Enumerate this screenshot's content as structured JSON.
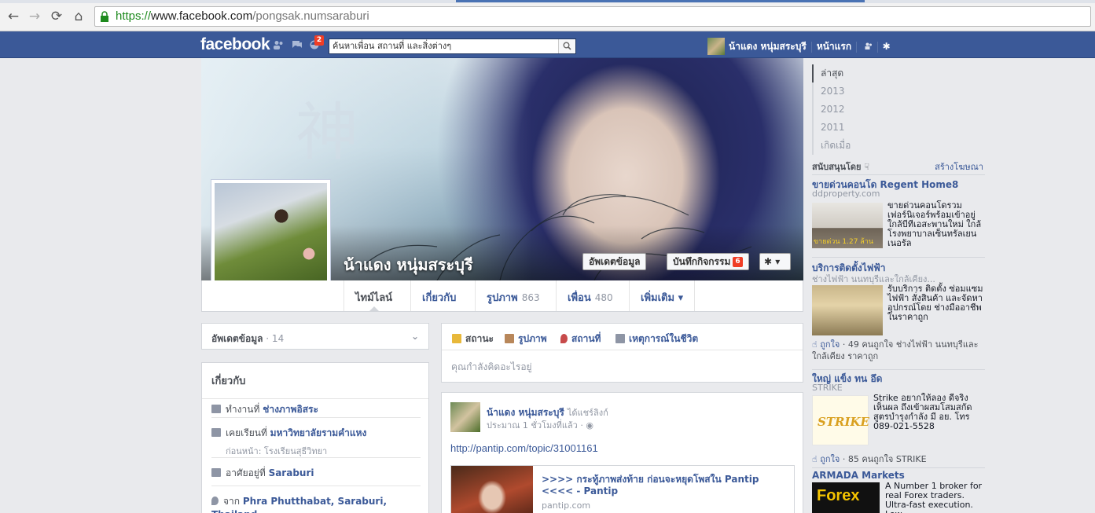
{
  "browser": {
    "url_scheme": "https://",
    "url_host": "www.facebook.com",
    "url_path": "/pongsak.numsaraburi",
    "back": "←",
    "forward": "→",
    "reload": "⟳",
    "home": "⌂"
  },
  "topbar": {
    "logo": "facebook",
    "notification_count": "2",
    "search_placeholder": "ค้นหาเพื่อน สถานที่ และสิ่งต่างๆ",
    "user_name": "น้าแดง หนุ่มสระบุรี",
    "home_link": "หน้าแรก",
    "settings_glyph": "✱"
  },
  "cover": {
    "profile_name": "น้าแดง หนุ่มสระบุรี",
    "update_info_label": "อัพเดตข้อมูล",
    "activity_log_label": "บันทึกกิจกรรม",
    "activity_badge": "6",
    "gear_glyph": "✱ ▾",
    "art_glyph": "神"
  },
  "nav_tabs": [
    {
      "label": "ไทม์ไลน์",
      "count": ""
    },
    {
      "label": "เกี่ยวกับ",
      "count": ""
    },
    {
      "label": "รูปภาพ",
      "count": "863"
    },
    {
      "label": "เพื่อน",
      "count": "480"
    },
    {
      "label": "เพิ่มเติม ▾",
      "count": ""
    }
  ],
  "left": {
    "updates_title": "อัพเดตข้อมูล",
    "updates_count": " · 14",
    "chevron": "⌄",
    "about_title": "เกี่ยวกับ",
    "rows": [
      {
        "prefix": "ทำงานที่ ",
        "value": "ช่างภาพอิสระ",
        "sub": ""
      },
      {
        "prefix": "เคยเรียนที่ ",
        "value": "มหาวิทยาลัยรามคำแหง",
        "sub": "ก่อนหน้า: โรงเรียนสุธีวิทยา"
      },
      {
        "prefix": "อาศัยอยู่ที่ ",
        "value": "Saraburi",
        "sub": ""
      },
      {
        "prefix": "จาก ",
        "value": "Phra Phutthabat, Saraburi, Thailand",
        "sub": ""
      }
    ]
  },
  "composer": {
    "tabs": [
      "สถานะ",
      "รูปภาพ",
      "สถานที่",
      "เหตุการณ์ในชีวิต"
    ],
    "placeholder": "คุณกำลังคิดอะไรอยู่"
  },
  "story": {
    "author": "น้าแดง หนุ่มสระบุรี",
    "action": "ได้แชร์ลิงก์",
    "time": "ประมาณ 1 ชั่วโมงที่แล้ว · ◉",
    "link": "http://pantip.com/topic/31001161",
    "att_title": ">>>> กระทู้ภาพส่งท้าย ก่อนจะหยุดโพสใน Pantip <<<< - Pantip",
    "att_domain": "pantip.com"
  },
  "timeline_years": [
    "ล่าสุด",
    "2013",
    "2012",
    "2011",
    "เกิดเมื่อ"
  ],
  "ads": {
    "sponsored": "สนับสนุนโดย ☟",
    "create_ad": "สร้างโฆษณา",
    "items": [
      {
        "title": "ขายด่วนคอนโด Regent Home8",
        "sub": "ddproperty.com",
        "body": "ขายด่วนคอนโดรวม เฟอร์นิเจอร์พร้อมเข้าอยู่ ใกล้บีทีเอสะพานใหม่ ใกล้ โรงพยาบาลเซ็นทรัลเยน เนอรัล",
        "img_caption": "ขายด่วน 1.27 ล้าน",
        "likes": "",
        "like_link": ""
      },
      {
        "title": "บริการติดตั้งไฟฟ้า",
        "sub": "ช่างไฟฟ้า นนทบุรีและใกล้เคียง...",
        "body": "รับบริการ ติดตั้ง ซ่อมแซม ไฟฟ้า สั่งสินค้า และจัดหาอุปกรณ์โดย ช่างมืออาชีพในราคาถูก",
        "img_caption": "",
        "likes": " · 49 คนถูกใจ ช่างไฟฟ้า นนทบุรีและใกล้เคียง ราคาถูก",
        "like_link": "ถูกใจ"
      },
      {
        "title": "ใหญ่ แข็ง ทน อึด",
        "sub": "STRIKE",
        "body": "Strike อยากให้ลอง ดีจริง เห็นผล ถึงเข้าผสมโสมสกัด สูตรบำรุงกำลัง มี อย. โทร 089-021-5528",
        "img_caption": "STRIKE",
        "likes": " · 85 คนถูกใจ STRIKE",
        "like_link": "ถูกใจ"
      },
      {
        "title": "ARMADA Markets",
        "sub": "",
        "body": "A Number 1 broker for real Forex traders. Ultra-fast execution. Low",
        "img_caption": "Forex",
        "likes": "",
        "like_link": ""
      }
    ]
  }
}
